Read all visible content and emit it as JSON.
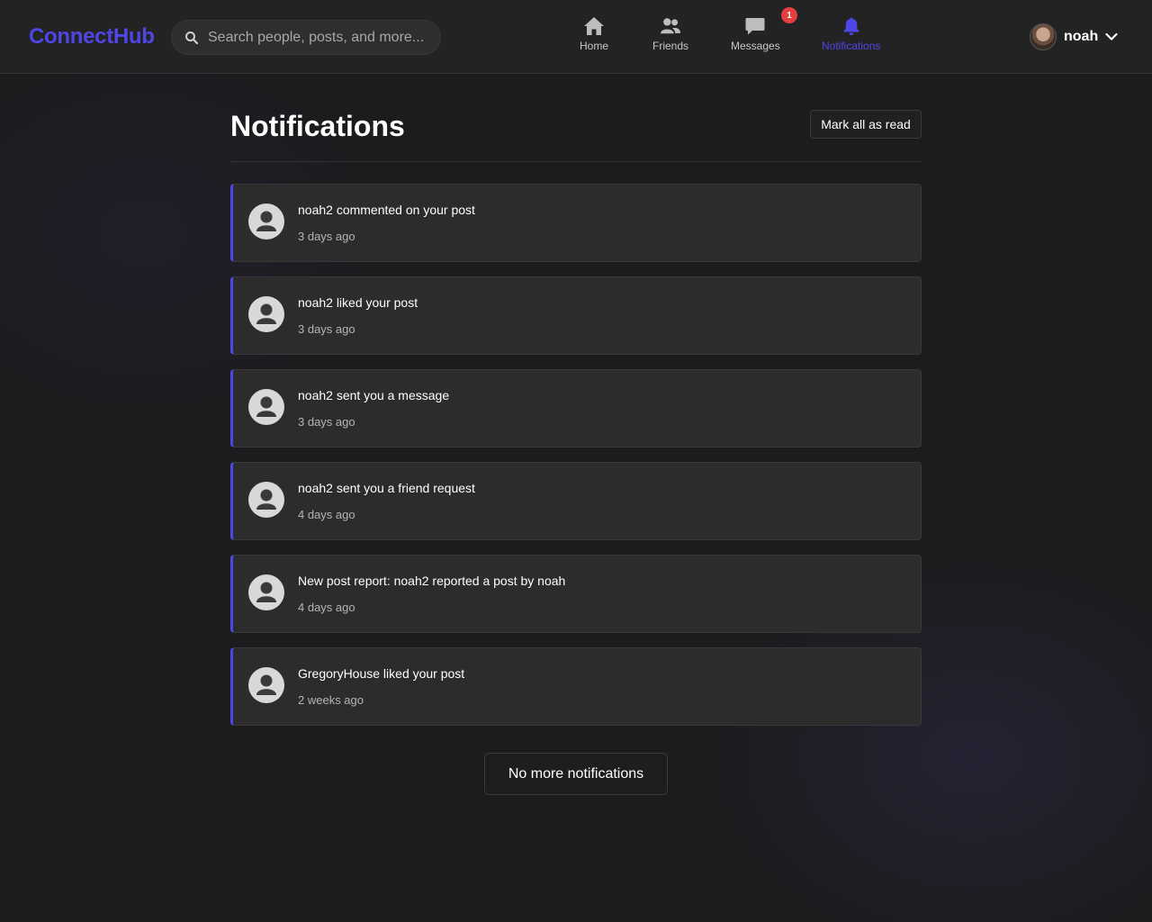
{
  "header": {
    "logo": "ConnectHub",
    "search": {
      "placeholder": "Search people, posts, and more..."
    },
    "nav": [
      {
        "label": "Home",
        "icon": "home-icon"
      },
      {
        "label": "Friends",
        "icon": "friends-icon"
      },
      {
        "label": "Messages",
        "icon": "messages-icon",
        "badge": "1"
      },
      {
        "label": "Notifications",
        "icon": "bell-icon",
        "active": true
      }
    ],
    "user": {
      "name": "noah"
    },
    "colors": {
      "accent": "#5046e5",
      "badge": "#e53e3e"
    }
  },
  "main": {
    "title": "Notifications",
    "mark_all_label": "Mark all as read",
    "notifications": [
      {
        "text": "noah2 commented on your post",
        "time": "3 days ago"
      },
      {
        "text": "noah2 liked your post",
        "time": "3 days ago"
      },
      {
        "text": "noah2 sent you a message",
        "time": "3 days ago"
      },
      {
        "text": "noah2 sent you a friend request",
        "time": "4 days ago"
      },
      {
        "text": "New post report: noah2 reported a post by noah",
        "time": "4 days ago"
      },
      {
        "text": "GregoryHouse liked your post",
        "time": "2 weeks ago"
      }
    ],
    "no_more_label": "No more notifications"
  }
}
